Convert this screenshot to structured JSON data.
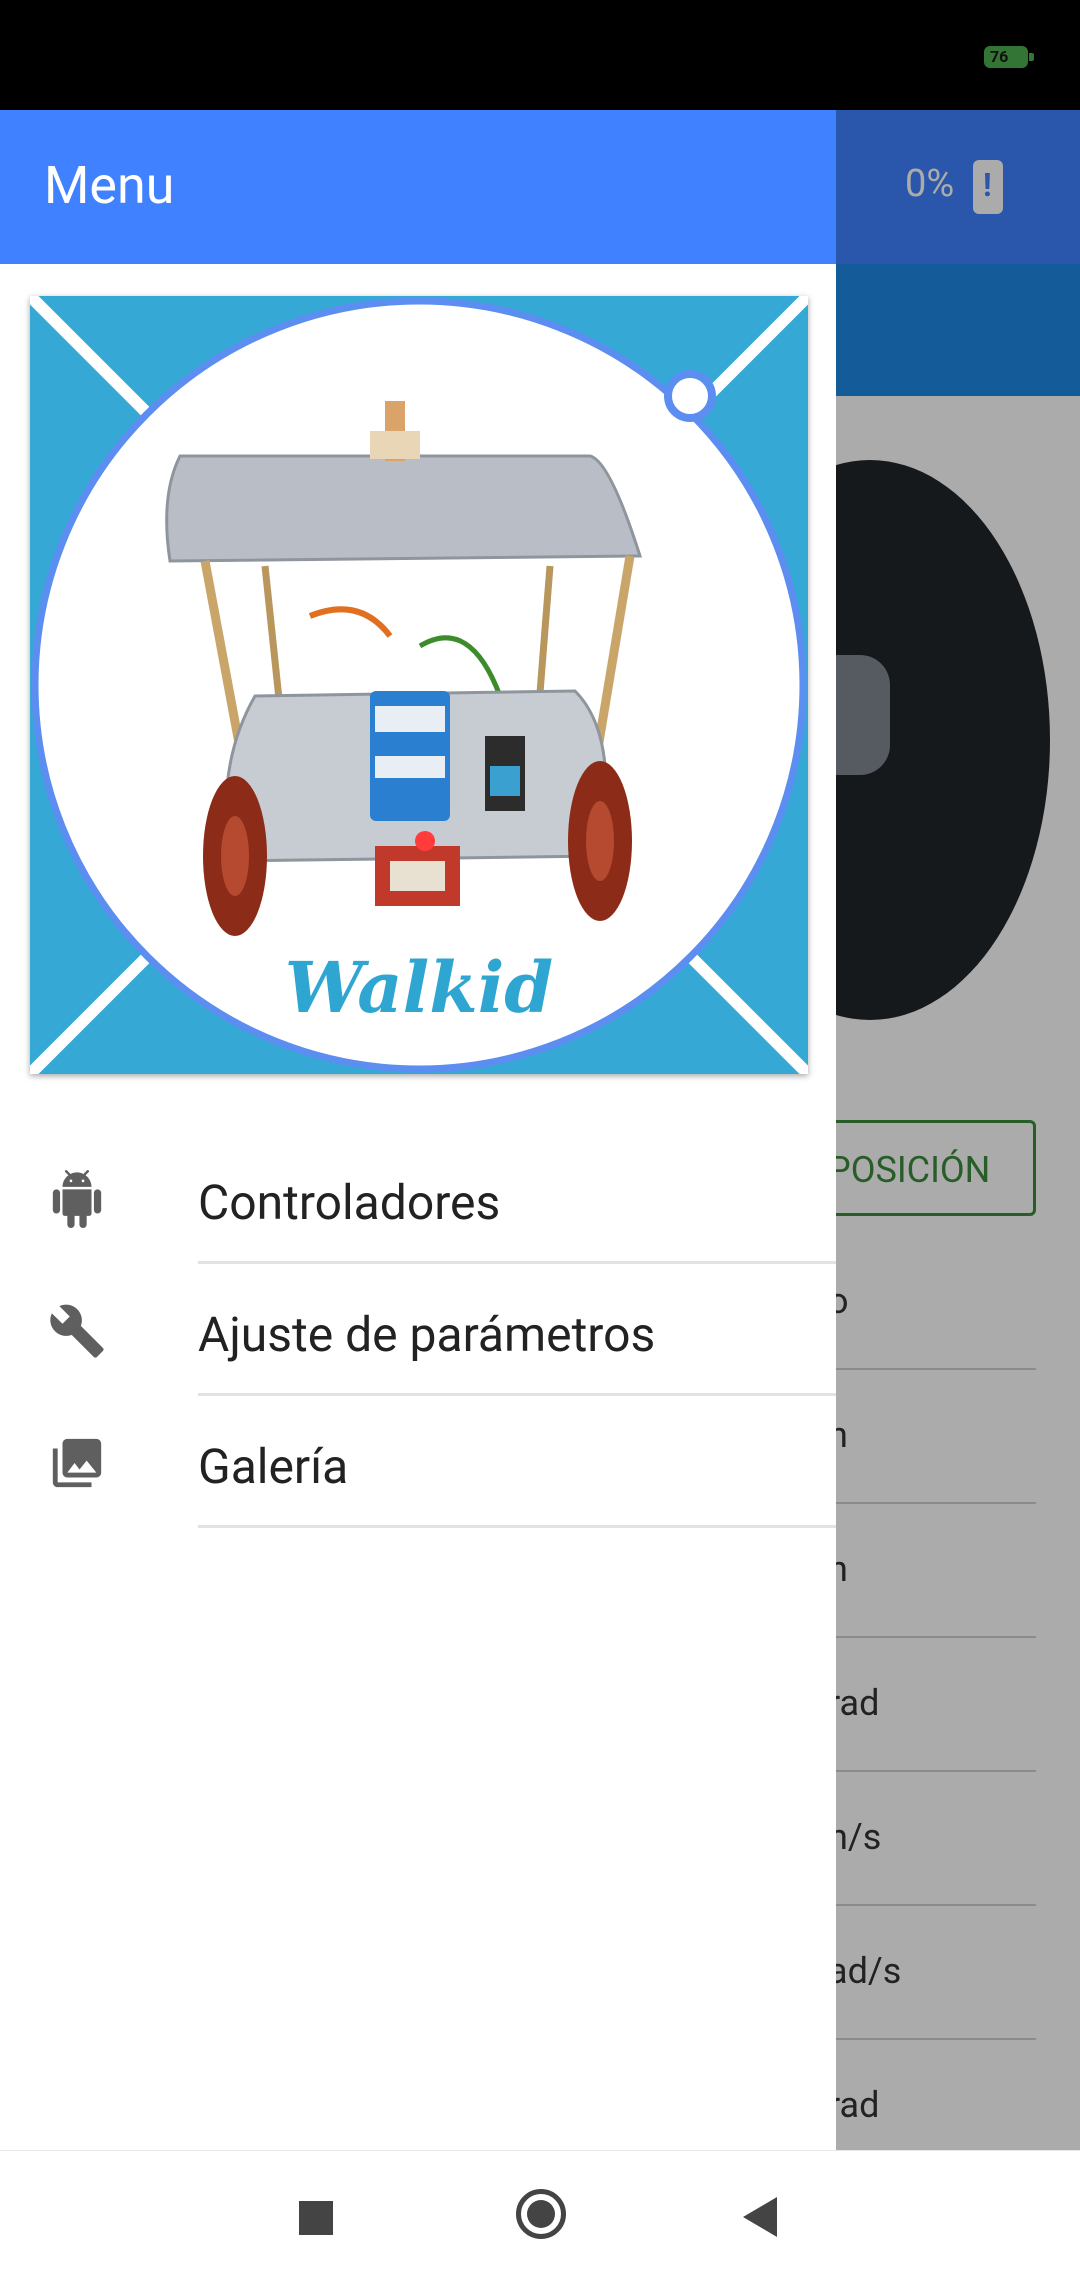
{
  "status_bar": {
    "battery_level": "76",
    "battery_color": "#4caf50"
  },
  "background_app": {
    "toolbar_color": "#3f81ff",
    "battery_percent": "0%",
    "position_button": "POSICIÓN",
    "rows": [
      "o",
      "n",
      "n",
      "rad",
      "n/s",
      "ad/s",
      "rad"
    ]
  },
  "drawer": {
    "title": "Menu",
    "header_color": "#3f81ff",
    "logo": {
      "text": "Walkid",
      "color": "#35a8d6",
      "image": "robot-photo"
    },
    "items": [
      {
        "label": "Controladores",
        "icon": "android-icon"
      },
      {
        "label": "Ajuste de parámetros",
        "icon": "wrench-icon"
      },
      {
        "label": "Galería",
        "icon": "gallery-icon"
      }
    ]
  },
  "nav_bar": {
    "recent": "square",
    "home": "circle",
    "back": "triangle"
  }
}
